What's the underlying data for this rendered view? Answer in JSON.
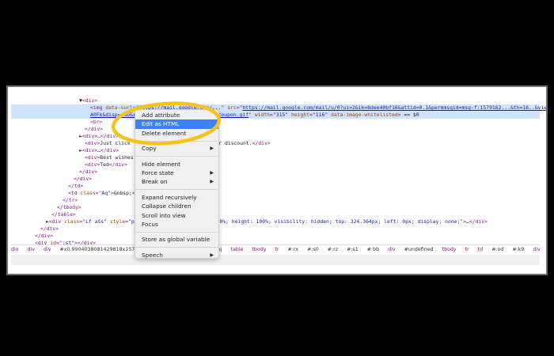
{
  "elements_tree": [
    {
      "indent": 90,
      "segs": [
        [
          "x",
          "▼"
        ],
        [
          "t",
          "<div>"
        ]
      ]
    },
    {
      "indent": 104,
      "segs": [
        [
          "t",
          "<img "
        ],
        [
          "a",
          "data-surl"
        ],
        [
          "t",
          "=\""
        ],
        [
          "v",
          "https://mail.google.com/..."
        ],
        [
          "t",
          "\" "
        ],
        [
          "a",
          "src"
        ],
        [
          "t",
          "=\""
        ],
        [
          "u",
          "https://mail.google.com/mail/u/0?ui=2&ik=8dee40bf16&attid=0.1&permmsgid=msg-f:1579162...&th=16..&view=fimg&sz=s0-l75-ft&attbid=ANGjdJ_Zx-HrYR84lzkcmCQKRtXEI-vCSTh45_PsfIp="
        ]
      ]
    },
    {
      "indent": 104,
      "segs": [
        [
          "u",
          "A0Fk&disp=emb&realattid=...%20percent_off_coupon.gif"
        ],
        [
          "t",
          "\" "
        ],
        [
          "a",
          "width"
        ],
        [
          "t",
          "=\""
        ],
        [
          "v",
          "315"
        ],
        [
          "t",
          "\" "
        ],
        [
          "a",
          "height"
        ],
        [
          "t",
          "=\""
        ],
        [
          "v",
          "116"
        ],
        [
          "t",
          "\" "
        ],
        [
          "a",
          "data-image-whitelisted"
        ],
        [
          "t",
          ">"
        ],
        [
          "x",
          " == $0"
        ]
      ]
    },
    {
      "indent": 104,
      "segs": [
        [
          "t",
          "<br>"
        ]
      ]
    },
    {
      "indent": 97,
      "segs": [
        [
          "t",
          "</div>"
        ]
      ]
    },
    {
      "indent": 90,
      "segs": [
        [
          "x",
          "►"
        ],
        [
          "t",
          "<div>"
        ],
        [
          "x",
          "…"
        ],
        [
          "t",
          "</div>"
        ]
      ]
    },
    {
      "indent": 97,
      "segs": [
        [
          "t",
          "<div>"
        ],
        [
          "x",
          "Just click the link below to redeem your discount."
        ],
        [
          "t",
          "</div>"
        ]
      ]
    },
    {
      "indent": 90,
      "segs": [
        [
          "x",
          "►"
        ],
        [
          "t",
          "<div>"
        ],
        [
          "x",
          "…"
        ],
        [
          "t",
          "</div>"
        ]
      ]
    },
    {
      "indent": 97,
      "segs": [
        [
          "t",
          "<div>"
        ],
        [
          "x",
          "Best wishes,"
        ],
        [
          "t",
          "</div>"
        ]
      ]
    },
    {
      "indent": 97,
      "segs": [
        [
          "t",
          "<div>"
        ],
        [
          "x",
          "Ted"
        ],
        [
          "t",
          "</div>"
        ]
      ]
    },
    {
      "indent": 90,
      "segs": [
        [
          "t",
          "</div>"
        ]
      ]
    },
    {
      "indent": 83,
      "segs": [
        [
          "t",
          "</div>"
        ]
      ]
    },
    {
      "indent": 76,
      "segs": [
        [
          "t",
          "</td>"
        ]
      ]
    },
    {
      "indent": 76,
      "segs": [
        [
          "t",
          "<td "
        ],
        [
          "a",
          "class"
        ],
        [
          "t",
          "=\""
        ],
        [
          "v",
          "Aq"
        ],
        [
          "t",
          "\">"
        ],
        [
          "x",
          "&nbsp;"
        ],
        [
          "t",
          "</td>"
        ]
      ]
    },
    {
      "indent": 69,
      "segs": [
        [
          "t",
          "</tr>"
        ]
      ]
    },
    {
      "indent": 62,
      "segs": [
        [
          "t",
          "</tbody>"
        ]
      ]
    },
    {
      "indent": 55,
      "segs": [
        [
          "t",
          "</table>"
        ]
      ]
    },
    {
      "indent": 48,
      "segs": [
        [
          "x",
          "►"
        ],
        [
          "t",
          "<div "
        ],
        [
          "a",
          "class"
        ],
        [
          "t",
          "=\""
        ],
        [
          "v",
          "Lf aSs"
        ],
        [
          "t",
          "\" "
        ],
        [
          "a",
          "style"
        ],
        [
          "t",
          "=\""
        ],
        [
          "v",
          "position: absolute; width: 100%; height: 100%; visibility: hidden; top: 324.364px; left: 0px; display: none;"
        ],
        [
          "t",
          "\">"
        ],
        [
          "x",
          "…"
        ],
        [
          "t",
          "</div>"
        ]
      ]
    },
    {
      "indent": 41,
      "segs": [
        [
          "t",
          "</div>"
        ]
      ]
    },
    {
      "indent": 34,
      "segs": [
        [
          "t",
          "</div>"
        ]
      ]
    },
    {
      "indent": 34,
      "segs": [
        [
          "t",
          "<div "
        ],
        [
          "a",
          "id"
        ],
        [
          "t",
          "=\""
        ],
        [
          "v",
          ":st"
        ],
        [
          "t",
          "\"></div>"
        ]
      ]
    }
  ],
  "breadcrumbs": [
    [
      "ct",
      "div"
    ],
    [
      "ct",
      "div"
    ],
    [
      "ct",
      "div"
    ],
    [
      "ci",
      "#x0.9904038081429818x1579162"
    ],
    [
      "ci",
      "#:t9"
    ],
    [
      "ct",
      "tbody"
    ],
    [
      "ct",
      "tr"
    ],
    [
      "ci",
      "#:uj"
    ],
    [
      "ct",
      "table"
    ],
    [
      "ct",
      "tbody"
    ],
    [
      "ct",
      "tr"
    ],
    [
      "ci",
      "#:rx"
    ],
    [
      "ci",
      "#:s0"
    ],
    [
      "ci",
      "#:rz"
    ],
    [
      "ci",
      "#:s1"
    ],
    [
      "ci",
      "#:bb"
    ],
    [
      "ct",
      "div"
    ],
    [
      "ci",
      "#undefined"
    ],
    [
      "ct",
      "tbody"
    ],
    [
      "ct",
      "tr"
    ],
    [
      "ct",
      "td"
    ],
    [
      "ci",
      "#:vd"
    ],
    [
      "ci",
      "#:k9"
    ],
    [
      "ct",
      "div"
    ]
  ],
  "context_menu": {
    "groups": [
      [
        {
          "label": "Add attribute"
        },
        {
          "label": "Edit as HTML",
          "highlighted": true
        },
        {
          "label": "Delete element"
        }
      ],
      [
        {
          "label": "Copy",
          "submenu": true
        }
      ],
      [
        {
          "label": "Hide element"
        },
        {
          "label": "Force state",
          "submenu": true
        },
        {
          "label": "Break on",
          "submenu": true
        }
      ],
      [
        {
          "label": "Expand recursively"
        },
        {
          "label": "Collapse children"
        },
        {
          "label": "Scroll into view"
        },
        {
          "label": "Focus"
        }
      ],
      [
        {
          "label": "Store as global variable"
        }
      ],
      [
        {
          "label": "Speech",
          "submenu": true
        }
      ]
    ]
  },
  "annotation": {
    "color": "#f2c41c",
    "highlight": "Edit as HTML"
  },
  "colors": {
    "selection": "#cfe3fb",
    "menu_highlight": "#3b82f6",
    "tag": "#881280",
    "attr": "#994500",
    "value": "#1a1aa6"
  }
}
